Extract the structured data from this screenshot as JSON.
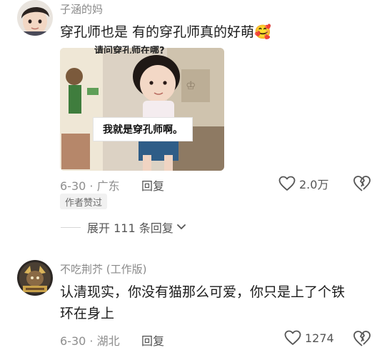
{
  "comments": [
    {
      "username": "子涵的妈",
      "text": "穿孔师也是 有的穿孔师真的好萌🥰",
      "image_caption": "我就是穿孔师啊。",
      "image_top_text": "请问穿孔师在哪?",
      "date": "6-30",
      "separator": "·",
      "location": "广东",
      "reply_label": "回复",
      "likes": "2.0万",
      "badge": "作者赞过",
      "expand_label": "展开 111 条回复",
      "icons": [
        "heart-icon",
        "broken-heart-icon",
        "chevron-down-icon"
      ]
    },
    {
      "username": "不吃荆芥 (工作版)",
      "text_line1": "认清现实，你没有猫那么可爱，你只是上了个铁",
      "text_line2": "环在身上",
      "date": "6-30",
      "separator": "·",
      "location": "湖北",
      "reply_label": "回复",
      "likes": "1274",
      "icons": [
        "heart-icon",
        "broken-heart-icon"
      ]
    }
  ],
  "colors": {
    "text": "#1b1b1b",
    "meta": "#8e8e8e",
    "username": "#8a8a8a",
    "badge_bg": "#f1f1f1"
  }
}
